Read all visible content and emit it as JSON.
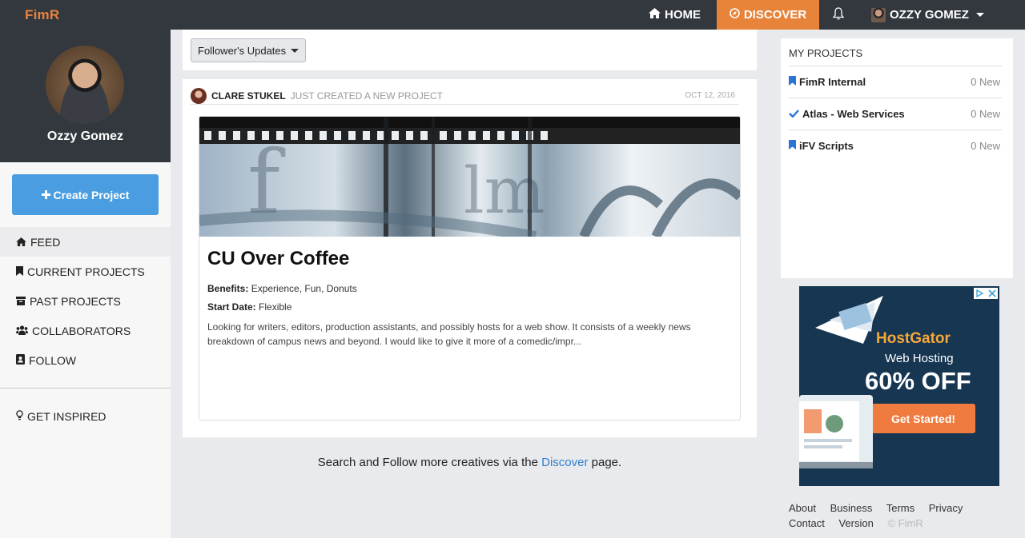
{
  "brand": "FimR",
  "nav": {
    "home": "HOME",
    "discover": "DISCOVER",
    "user": "OZZY GOMEZ"
  },
  "sidebar": {
    "name": "Ozzy Gomez",
    "create_label": "Create Project",
    "items": [
      {
        "label": "FEED",
        "icon": "home-icon"
      },
      {
        "label": "CURRENT PROJECTS",
        "icon": "bookmark-icon"
      },
      {
        "label": "PAST PROJECTS",
        "icon": "archive-icon"
      },
      {
        "label": "COLLABORATORS",
        "icon": "users-icon"
      },
      {
        "label": "FOLLOW",
        "icon": "contact-icon"
      }
    ],
    "inspired": "GET INSPIRED"
  },
  "filter": {
    "label": "Follower's Updates"
  },
  "feed": {
    "actor": "CLARE STUKEL",
    "action": "JUST CREATED A NEW PROJECT",
    "date": "OCT 12, 2016",
    "project": {
      "title": "CU Over Coffee",
      "benefits_label": "Benefits:",
      "benefits": "Experience, Fun, Donuts",
      "start_label": "Start Date:",
      "start": "Flexible",
      "description": "Looking for writers, editors, production assistants, and possibly hosts for a web show. It consists of a weekly news breakdown of campus news and beyond. I would like to give it more of a comedic/impr..."
    }
  },
  "discover_note": {
    "before": "Search and Follow more creatives via the",
    "link": "Discover",
    "after": "page."
  },
  "my_projects": {
    "title": "MY PROJECTS",
    "items": [
      {
        "name": "FimR Internal",
        "count": "0 New",
        "icon": "bookmark-icon"
      },
      {
        "name": "Atlas - Web Services",
        "count": "0 New",
        "icon": "check-icon"
      },
      {
        "name": "iFV Scripts",
        "count": "0 New",
        "icon": "bookmark-icon"
      }
    ]
  },
  "ad": {
    "brand": "HostGator",
    "sub": "Web Hosting",
    "offer": "60% OFF",
    "cta": "Get Started!"
  },
  "footer": {
    "links": [
      "About",
      "Business",
      "Terms",
      "Privacy",
      "Contact",
      "Version"
    ],
    "copyright": "© FimR"
  },
  "colors": {
    "accent": "#e8833a",
    "nav_bg": "#33383f",
    "primary": "#4a9de0",
    "link": "#2f7fd3"
  }
}
